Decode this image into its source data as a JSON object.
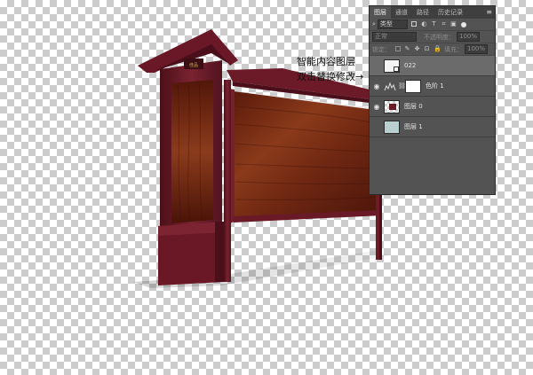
{
  "panel": {
    "tabs": [
      {
        "label": "图层"
      },
      {
        "label": "通道"
      },
      {
        "label": "路径"
      },
      {
        "label": "历史记录"
      }
    ],
    "filter_kind": "类型",
    "blend_mode": "正常",
    "opacity_label": "不透明度：",
    "opacity_value": "100%",
    "lock_label": "锁定：",
    "fill_label": "填充：",
    "fill_value": "100%",
    "layers": [
      {
        "name": "022",
        "visible": false,
        "selected": true
      },
      {
        "name": "色阶 1",
        "visible": true,
        "selected": false
      },
      {
        "name": "图层 0",
        "visible": true,
        "selected": false
      },
      {
        "name": "图层 1",
        "visible": false,
        "selected": false
      }
    ]
  },
  "annotation": {
    "line1": "智能内容图层",
    "line2": "双击替换修改→"
  },
  "colors": {
    "panel_bg": "#535353",
    "frame_maroon": "#6b1b26",
    "wood": "#7a2e16"
  }
}
